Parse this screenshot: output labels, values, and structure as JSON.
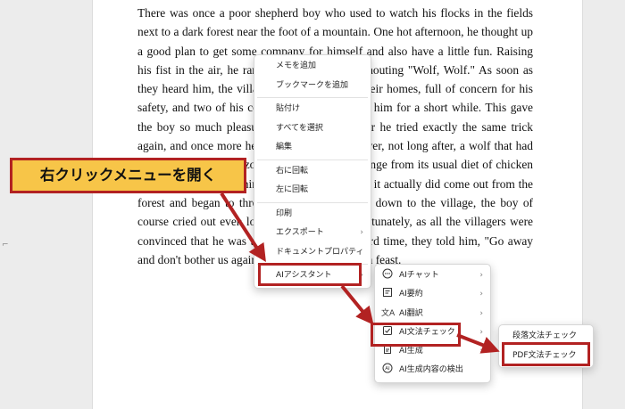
{
  "document": {
    "paragraph": "There was once a poor shepherd boy who used to watch his flocks in the fields next to a dark forest near the foot of a mountain. One hot afternoon, he thought up a good plan to get some company for himself and also have a little fun. Raising his fist in the air, he ran down to the village shouting \"Wolf, Wolf.\" As soon as they heard him, the villagers all rushed from their homes, full of concern for his safety, and two of his cousins even stayed with him for a short while. This gave the boy so much pleasure that a few days later he tried exactly the same trick again, and once more he was successful. However, not long after, a wolf that had just escaped from the zoo was looking for a change from its usual diet of chicken and duck. So, overcoming its fear of being shot, it actually did come out from the forest and began to threaten the sheep. Racing down to the village, the boy of course cried out even louder than before. Unfortunately, as all the villagers were convinced that he was trying to fool them a third time, they told him, \"Go away and don't bother us again.\" And so the wolf had a feast."
  },
  "context_menu": {
    "items": [
      {
        "label": "メモを追加"
      },
      {
        "label": "ブックマークを追加"
      },
      {
        "label": "貼付け"
      },
      {
        "label": "すべてを選択"
      },
      {
        "label": "編集"
      },
      {
        "label": "右に回転"
      },
      {
        "label": "左に回転"
      },
      {
        "label": "印刷"
      },
      {
        "label": "エクスポート"
      },
      {
        "label": "ドキュメントプロパティ"
      },
      {
        "label": "AIアシスタント"
      }
    ]
  },
  "ai_submenu": {
    "items": [
      {
        "label": "AIチャット",
        "icon": "chat-icon"
      },
      {
        "label": "AI要約",
        "icon": "summary-icon"
      },
      {
        "label": "AI翻訳",
        "icon": "translate-icon"
      },
      {
        "label": "AI文法チェック",
        "icon": "grammar-check-icon"
      },
      {
        "label": "AI生成",
        "icon": "generate-icon"
      },
      {
        "label": "AI生成内容の検出",
        "icon": "ai-detect-icon"
      }
    ]
  },
  "grammar_submenu": {
    "items": [
      {
        "label": "段落文法チェック"
      },
      {
        "label": "PDF文法チェック"
      }
    ]
  },
  "callout": {
    "text": "右クリックメニューを開く"
  },
  "colors": {
    "highlight": "#b22222",
    "callout_fill": "#f7c548"
  }
}
